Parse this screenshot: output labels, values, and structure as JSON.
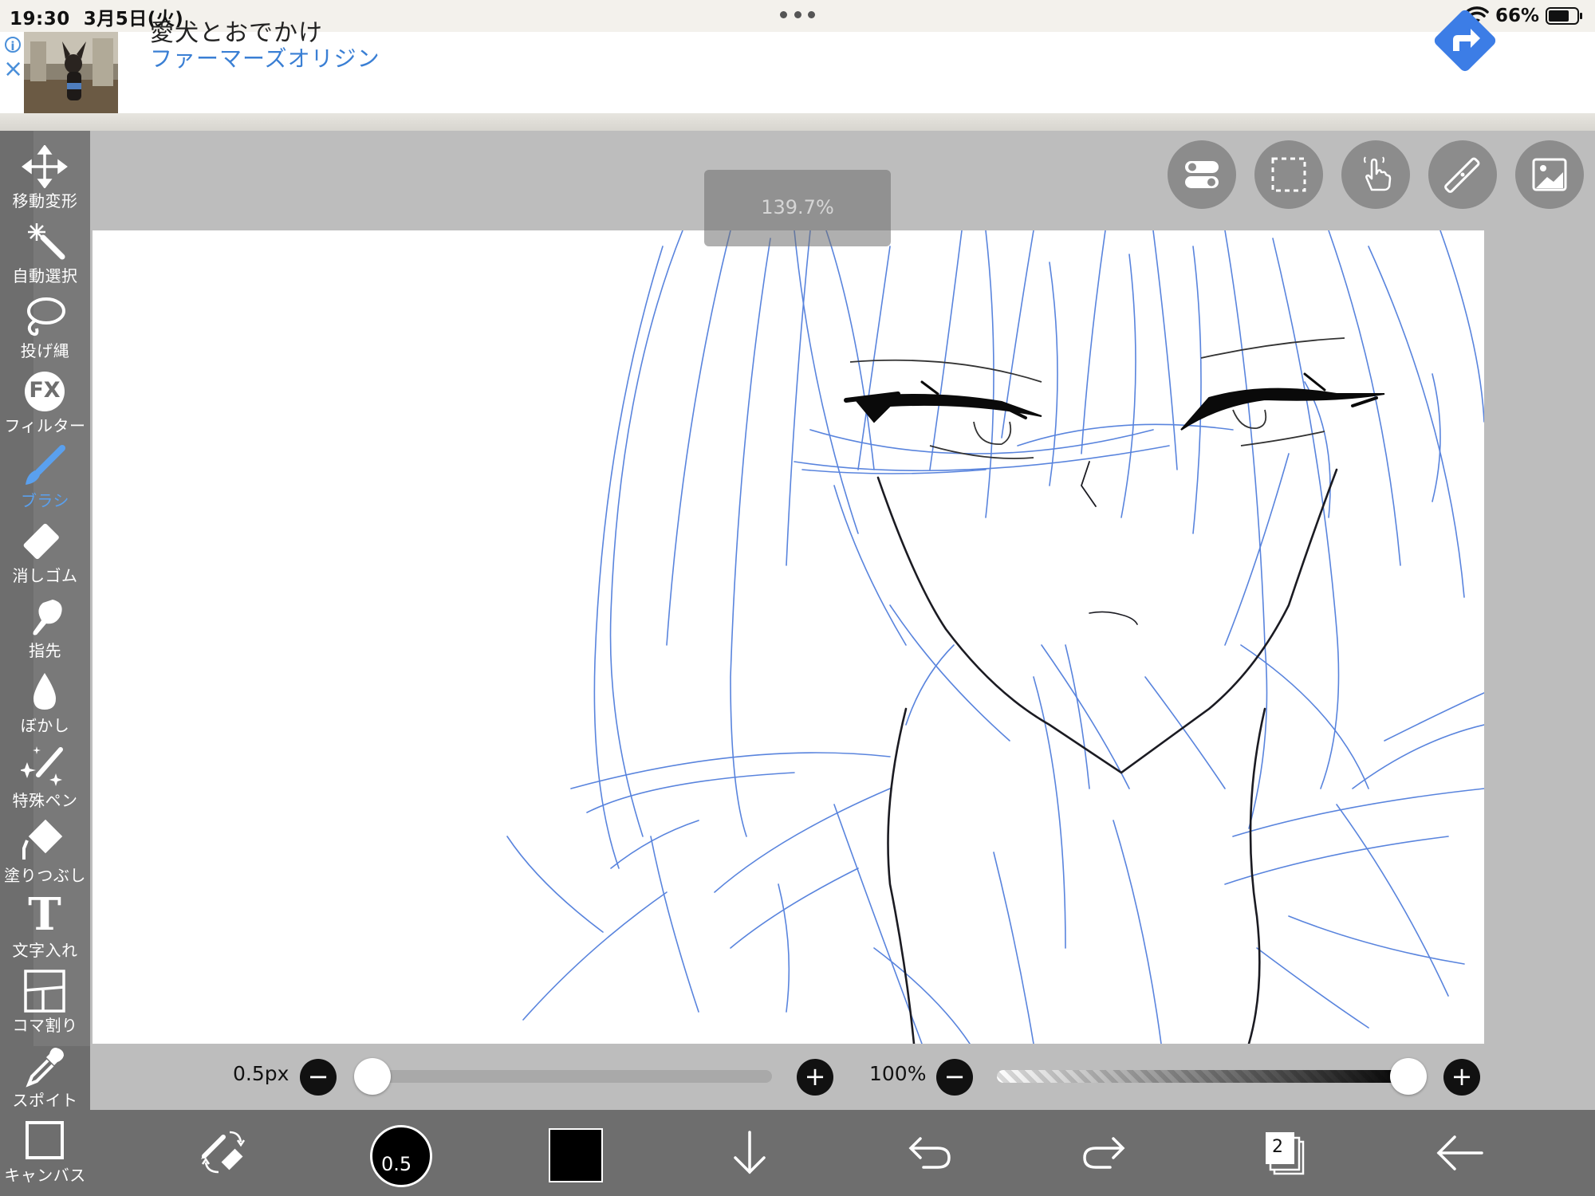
{
  "status_bar": {
    "time": "19:30",
    "date": "3月5日(火)",
    "battery": "66%"
  },
  "ad": {
    "title": "愛犬とおでかけ",
    "subtitle": "ファーマーズオリジン",
    "info_icon": "i",
    "close_icon": "×"
  },
  "left_toolbar": {
    "tools": [
      {
        "label": "移動変形",
        "icon": "move-icon"
      },
      {
        "label": "自動選択",
        "icon": "magic-wand-icon"
      },
      {
        "label": "投げ縄",
        "icon": "lasso-icon"
      },
      {
        "label": "フィルター",
        "icon": "fx-icon"
      },
      {
        "label": "ブラシ",
        "icon": "brush-icon",
        "active": true
      },
      {
        "label": "消しゴム",
        "icon": "eraser-icon"
      },
      {
        "label": "指先",
        "icon": "smudge-icon"
      },
      {
        "label": "ぼかし",
        "icon": "blur-icon"
      },
      {
        "label": "特殊ペン",
        "icon": "special-pen-icon"
      },
      {
        "label": "塗りつぶし",
        "icon": "fill-icon"
      },
      {
        "label": "文字入れ",
        "icon": "text-icon"
      },
      {
        "label": "コマ割り",
        "icon": "frame-divider-icon"
      },
      {
        "label": "スポイト",
        "icon": "eyedropper-icon"
      },
      {
        "label": "キャンバス",
        "icon": "canvas-icon"
      }
    ],
    "fx_glyph": "FX",
    "text_glyph": "T"
  },
  "canvas": {
    "zoom": "139.7%"
  },
  "sliders": {
    "brush_size": "0.5px",
    "brush_size_fraction": 0.0,
    "opacity": "100%",
    "opacity_fraction": 1.0,
    "minus": "−",
    "plus": "+"
  },
  "bottom_toolbar": {
    "brush_size_short": "0.5",
    "layer_count": "2",
    "accent_color": "#5aa0ee",
    "current_color": "#000000"
  }
}
